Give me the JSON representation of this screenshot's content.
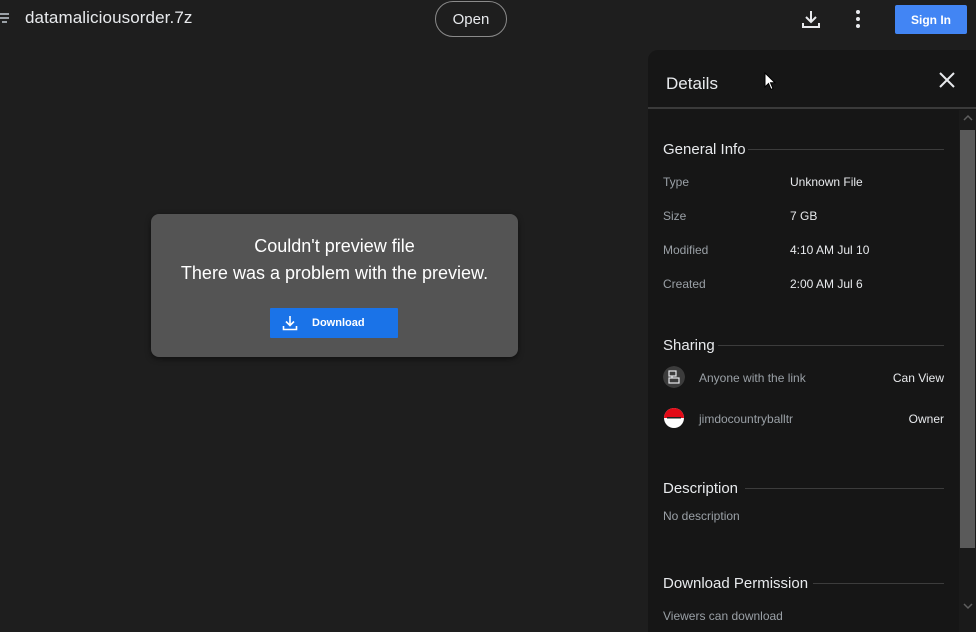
{
  "header": {
    "file_name": "datamaliciousorder.7z",
    "open_label": "Open",
    "signin_label": "Sign In"
  },
  "preview": {
    "title": "Couldn't preview file",
    "message": "There was a problem with the preview.",
    "download_label": "Download"
  },
  "details": {
    "title": "Details",
    "general": {
      "heading": "General Info",
      "rows": [
        {
          "label": "Type",
          "value": "Unknown File"
        },
        {
          "label": "Size",
          "value": "7 GB"
        },
        {
          "label": "Modified",
          "value": "4:10 AM Jul 10"
        },
        {
          "label": "Created",
          "value": "2:00 AM Jul 6"
        }
      ]
    },
    "sharing": {
      "heading": "Sharing",
      "entries": [
        {
          "name": "Anyone with the link",
          "role": "Can View",
          "icon": "link-share-icon"
        },
        {
          "name": "jimdocountryballtr",
          "role": "Owner",
          "icon": "user-avatar"
        }
      ]
    },
    "description": {
      "heading": "Description",
      "text": "No description"
    },
    "download_permission": {
      "heading": "Download Permission",
      "text": "Viewers can download"
    }
  },
  "colors": {
    "background": "#1e1e1e",
    "panel": "#161616",
    "accent": "#1a73e8",
    "signin": "#4285f4"
  }
}
